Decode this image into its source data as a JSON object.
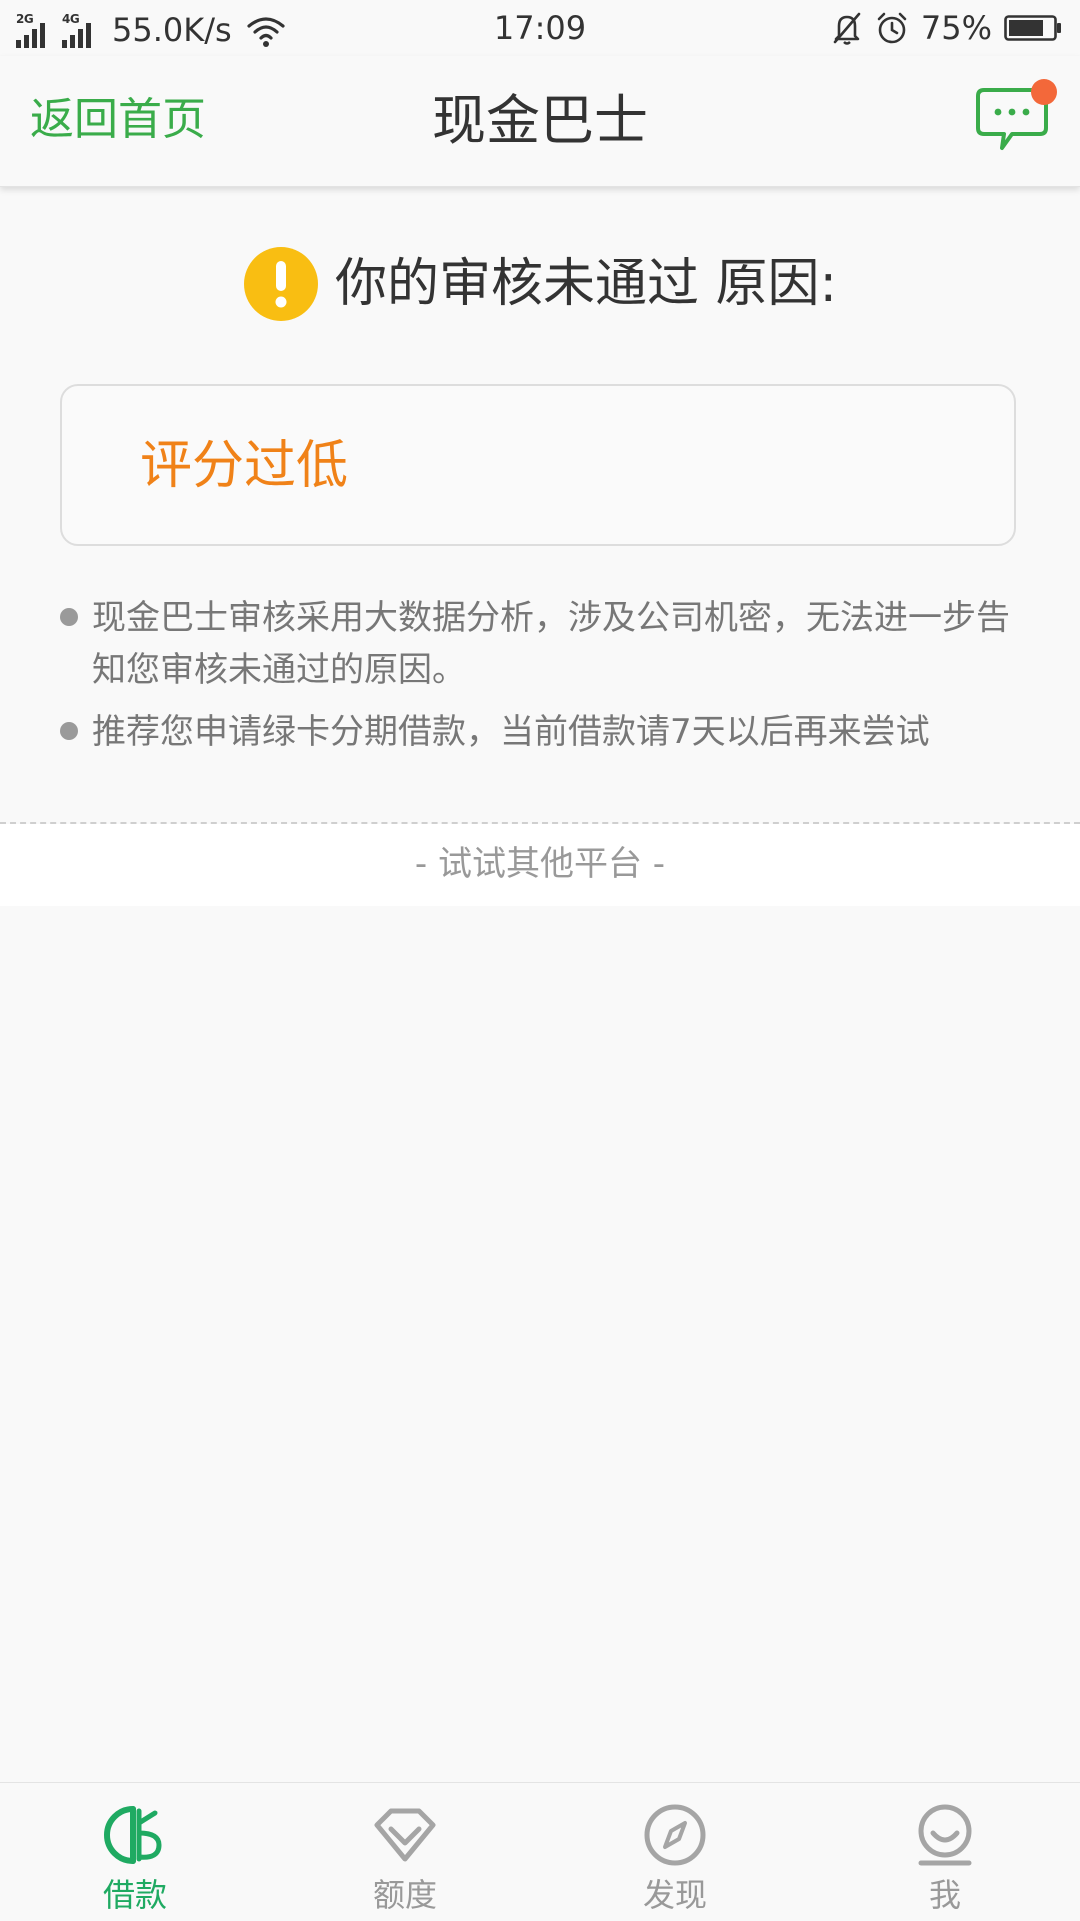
{
  "status_bar": {
    "network_1": "2G",
    "network_2": "4G",
    "speed": "55.0K/s",
    "time": "17:09",
    "battery": "75%"
  },
  "header": {
    "back_label": "返回首页",
    "title": "现金巴士"
  },
  "notice": {
    "title": "你的审核未通过 原因:",
    "reason": "评分过低"
  },
  "tips": [
    "现金巴士审核采用大数据分析，涉及公司机密，无法进一步告知您审核未通过的原因。",
    "推荐您申请绿卡分期借款，当前借款请7天以后再来尝试"
  ],
  "others": {
    "label": "- 试试其他平台 -"
  },
  "nav": {
    "items": [
      {
        "label": "借款",
        "icon": "loan-icon",
        "active": true
      },
      {
        "label": "额度",
        "icon": "diamond-icon",
        "active": false
      },
      {
        "label": "发现",
        "icon": "compass-icon",
        "active": false
      },
      {
        "label": "我",
        "icon": "profile-icon",
        "active": false
      }
    ]
  },
  "colors": {
    "brand_green": "#3aac4a",
    "nav_active": "#1faa62",
    "reason_orange": "#f08218",
    "warning_yellow": "#f9be12",
    "badge_red": "#f3683a"
  }
}
